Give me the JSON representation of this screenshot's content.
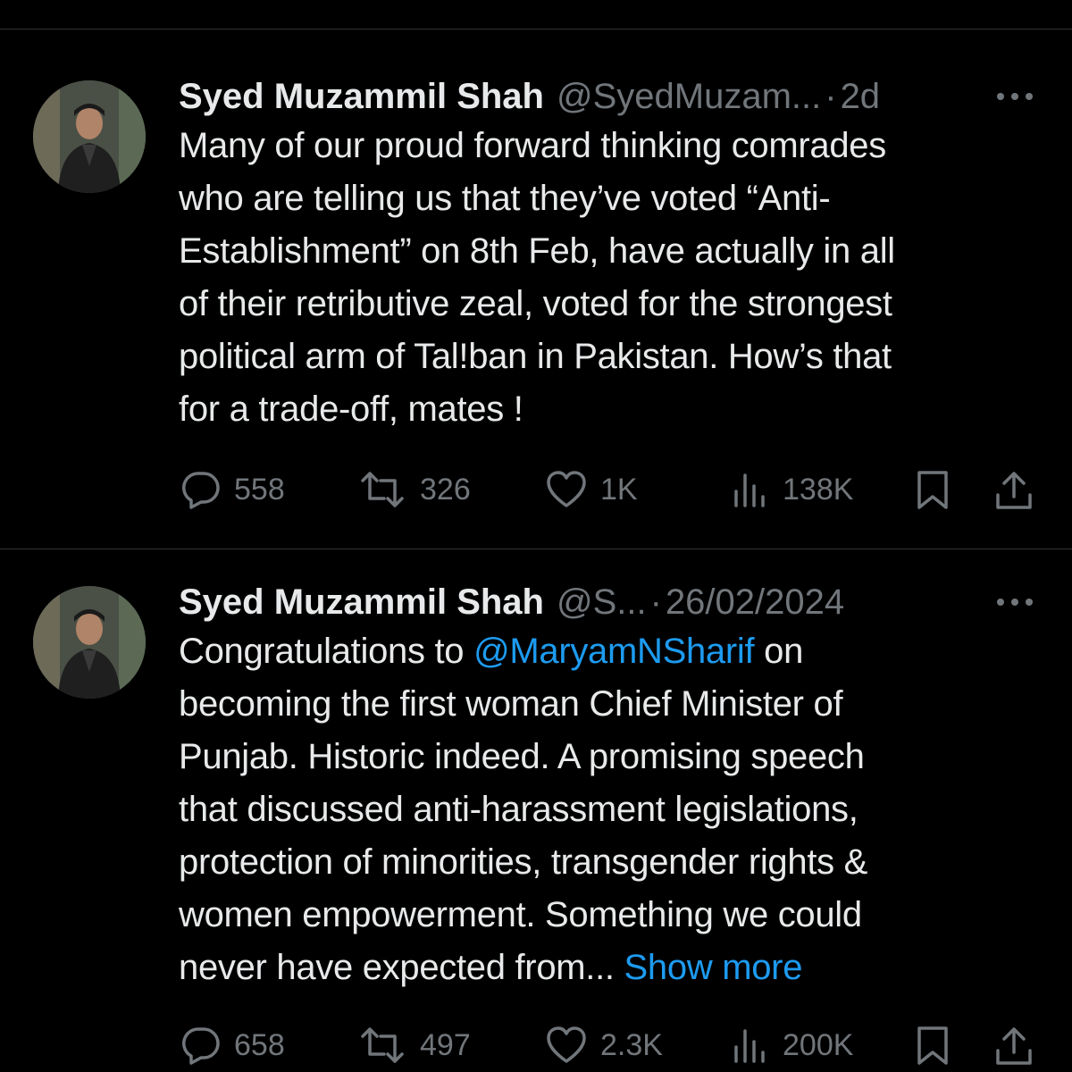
{
  "tweets": [
    {
      "author_name": "Syed Muzammil Shah",
      "handle": "@SyedMuzam...",
      "separator": "·",
      "time": "2d",
      "body_lines": [
        "Many of our proud forward thinking comrades",
        "who are telling us that they’ve voted “Anti-",
        "Establishment” on 8th Feb, have actually in all",
        "of their retributive zeal, voted for the strongest",
        "political arm of Tal!ban in Pakistan. How’s that",
        "for a trade-off, mates !"
      ],
      "replies": "558",
      "reposts": "326",
      "likes": "1K",
      "views": "138K"
    },
    {
      "author_name": "Syed Muzammil Shah",
      "handle": "@S...",
      "separator": "·",
      "time": "26/02/2024",
      "body_line1_prefix": "Congratulations to ",
      "mention": "@MaryamNSharif",
      "body_line1_suffix": " on",
      "body_lines": [
        "becoming the first woman Chief Minister of",
        "Punjab. Historic indeed. A promising speech",
        "that discussed anti-harassment legislations,",
        "protection of minorities, transgender rights &",
        "women empowerment. Something we could"
      ],
      "last_line_prefix": "never have expected from... ",
      "show_more": "Show more",
      "replies": "658",
      "reposts": "497",
      "likes": "2.3K",
      "views": "200K"
    }
  ],
  "icons": {
    "reply": "reply-icon",
    "repost": "repost-icon",
    "like": "heart-icon",
    "views": "views-icon",
    "bookmark": "bookmark-icon",
    "share": "share-icon",
    "more": "more-icon"
  },
  "colors": {
    "background": "#000000",
    "text": "#e7e9ea",
    "secondary": "#71767b",
    "link": "#1d9bf0",
    "divider": "#2f3336"
  }
}
